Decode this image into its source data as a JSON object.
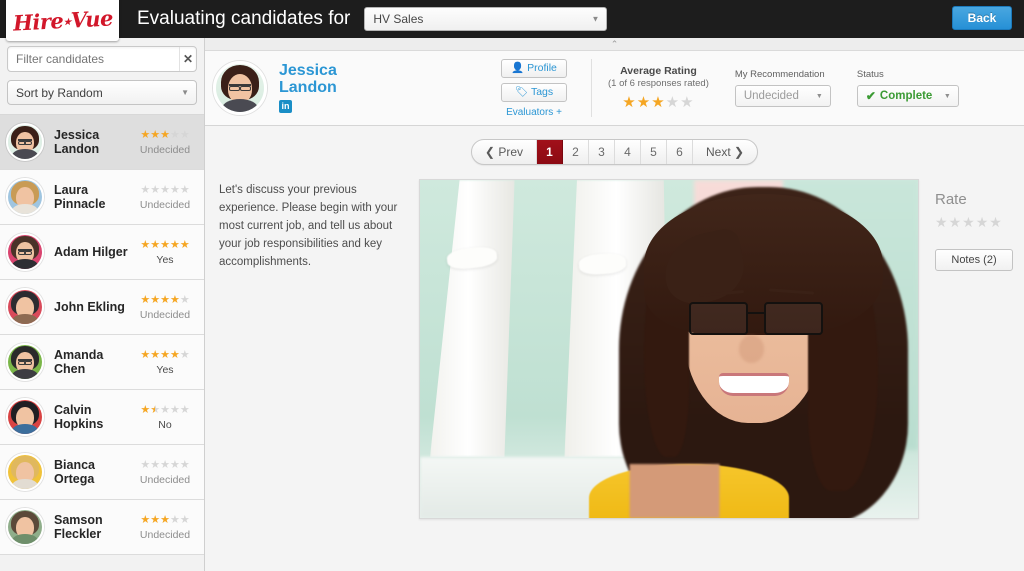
{
  "topbar": {
    "logo": "Hire",
    "logo2": "Vue",
    "title": "Evaluating candidates for",
    "position_value": "HV Sales",
    "back_label": "Back",
    "caret": "▼"
  },
  "sidebar": {
    "filter_placeholder": "Filter candidates",
    "filter_value": "",
    "clear_icon": "✕",
    "sort_label": "Sort by Random",
    "caret": "▼",
    "candidates": [
      {
        "name": "Jessica Landon",
        "rating": 3,
        "recommendation": "Undecided",
        "selected": true,
        "hair": "#3a2018",
        "bg": "#dff0e6",
        "body": "#4a4a52"
      },
      {
        "name": "Laura Pinnacle",
        "rating": 0,
        "recommendation": "Undecided",
        "selected": false,
        "hair": "#c99b55",
        "bg": "#9fc5e0",
        "body": "#e8e3da"
      },
      {
        "name": "Adam Hilger",
        "rating": 5,
        "recommendation": "Yes",
        "selected": false,
        "hair": "#4a3328",
        "bg": "#d9446f",
        "body": "#2e2e33"
      },
      {
        "name": "John Ekling",
        "rating": 4,
        "recommendation": "Undecided",
        "selected": false,
        "hair": "#2c2c30",
        "bg": "#d94a5a",
        "body": "#8d6a52"
      },
      {
        "name": "Amanda Chen",
        "rating": 4,
        "recommendation": "Yes",
        "selected": false,
        "hair": "#2a2a2a",
        "bg": "#7ab648",
        "body": "#3d3d42"
      },
      {
        "name": "Calvin Hopkins",
        "rating": 1.5,
        "recommendation": "No",
        "selected": false,
        "hair": "#1f1f23",
        "bg": "#d94343",
        "body": "#3c6e9c"
      },
      {
        "name": "Bianca Ortega",
        "rating": 0,
        "recommendation": "Undecided",
        "selected": false,
        "hair": "#e0b85e",
        "bg": "#f0c23a",
        "body": "#e2dcd2"
      },
      {
        "name": "Samson Fleckler",
        "rating": 3,
        "recommendation": "Undecided",
        "selected": false,
        "hair": "#5c4a3a",
        "bg": "#8fae8a",
        "body": "#6f8f6b"
      }
    ]
  },
  "header": {
    "collapse_icon": "⌃",
    "candidate_first": "Jessica",
    "candidate_last": "Landon",
    "linkedin_label": "in",
    "profile_label": "Profile",
    "profile_icon": "👤",
    "tags_label": "Tags",
    "tags_icon": "🏷",
    "evaluators_label": "Evaluators +",
    "avg_rating_title": "Average Rating",
    "avg_rating_sub": "(1 of 6 responses rated)",
    "avg_rating_value": 3,
    "recommendation_label": "My Recommendation",
    "recommendation_value": "Undecided",
    "status_label": "Status",
    "status_value": "Complete",
    "status_check": "✔",
    "caret": "▼"
  },
  "pager": {
    "prev_label": "Prev",
    "prev_icon": "❮",
    "next_label": "Next",
    "next_icon": "❯",
    "pages": [
      "1",
      "2",
      "3",
      "4",
      "5",
      "6"
    ],
    "active_page": "1"
  },
  "content": {
    "question": "Let's discuss your previous experience. Please begin with your most current job, and tell us about your job responsibilities and key accomplishments.",
    "rate_title": "Rate",
    "rate_value": 0,
    "notes_label": "Notes (2)"
  },
  "colors": {
    "brand_red": "#d2172a",
    "accent_blue": "#2b96d4",
    "star_on": "#f5a623",
    "star_off": "#d6d6d6",
    "status_green": "#3b9b34",
    "active_page_red": "#8c0a13"
  }
}
